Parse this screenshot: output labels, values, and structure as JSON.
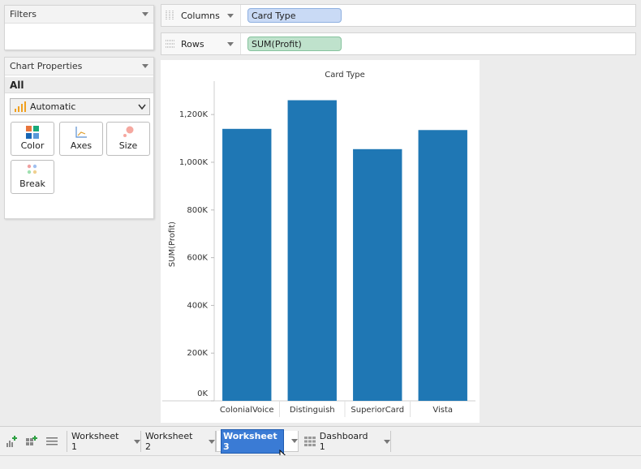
{
  "filters": {
    "title": "Filters"
  },
  "chart_properties": {
    "title": "Chart Properties",
    "scope": "All",
    "mark_type": "Automatic",
    "buttons": {
      "color": "Color",
      "axes": "Axes",
      "size": "Size",
      "break": "Break"
    }
  },
  "shelves": {
    "columns": {
      "label": "Columns",
      "pill": "Card Type"
    },
    "rows": {
      "label": "Rows",
      "pill": "SUM(Profit)"
    }
  },
  "chart_data": {
    "type": "bar",
    "title": "Card Type",
    "xlabel": "",
    "ylabel": "SUM(Profit)",
    "categories": [
      "ColonialVoice",
      "Distinguish",
      "SuperiorCard",
      "Vista"
    ],
    "values": [
      1140000,
      1260000,
      1055000,
      1135000
    ],
    "ylim": [
      0,
      1340000
    ],
    "yticks": [
      0,
      200000,
      400000,
      600000,
      800000,
      1000000,
      1200000
    ],
    "ytick_labels": [
      "0K",
      "200K",
      "400K",
      "600K",
      "800K",
      "1,000K",
      "1,200K"
    ],
    "bar_color": "#1f77b4",
    "grid": false
  },
  "tabs": [
    {
      "label": "Worksheet 1",
      "selected": false
    },
    {
      "label": "Worksheet 2",
      "selected": false
    },
    {
      "label": "Worksheet 3",
      "selected": true
    },
    {
      "label": "Dashboard 1",
      "selected": false
    }
  ],
  "colors": {
    "selected_tab_bg": "#3a7bd5",
    "dimension_pill": "#c9daf5",
    "measure_pill": "#bfe2cc"
  }
}
